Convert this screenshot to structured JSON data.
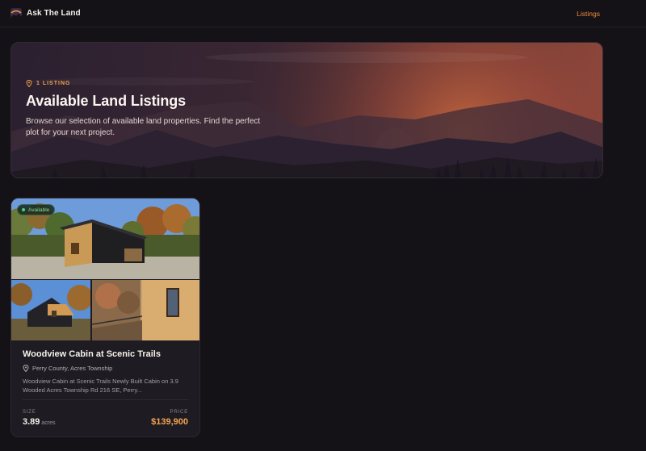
{
  "header": {
    "brand": "Ask The Land",
    "nav_listings": "Listings"
  },
  "hero": {
    "count_badge": "1 LISTING",
    "title": "Available Land Listings",
    "subtitle": "Browse our selection of available land properties. Find the perfect plot for your next project."
  },
  "listings": [
    {
      "status": "Available",
      "title": "Woodview Cabin at Scenic Trails",
      "location": "Perry County, Acres Township",
      "description": "Woodview Cabin at Scenic Trails Newly Built Cabin on 3.9 Wooded Acres Township Rd 216 SE, Perry...",
      "size_label": "SIZE",
      "size_value": "3.89",
      "size_unit": "acres",
      "price_label": "PRICE",
      "price_value": "$139,900"
    }
  ],
  "colors": {
    "accent": "#f08a3c",
    "price": "#f5a550",
    "available": "#4bd17b",
    "background": "#151217"
  },
  "icons": {
    "logo": "mountain-sunset-icon",
    "badge": "map-pin-icon",
    "location": "map-pin-icon"
  }
}
